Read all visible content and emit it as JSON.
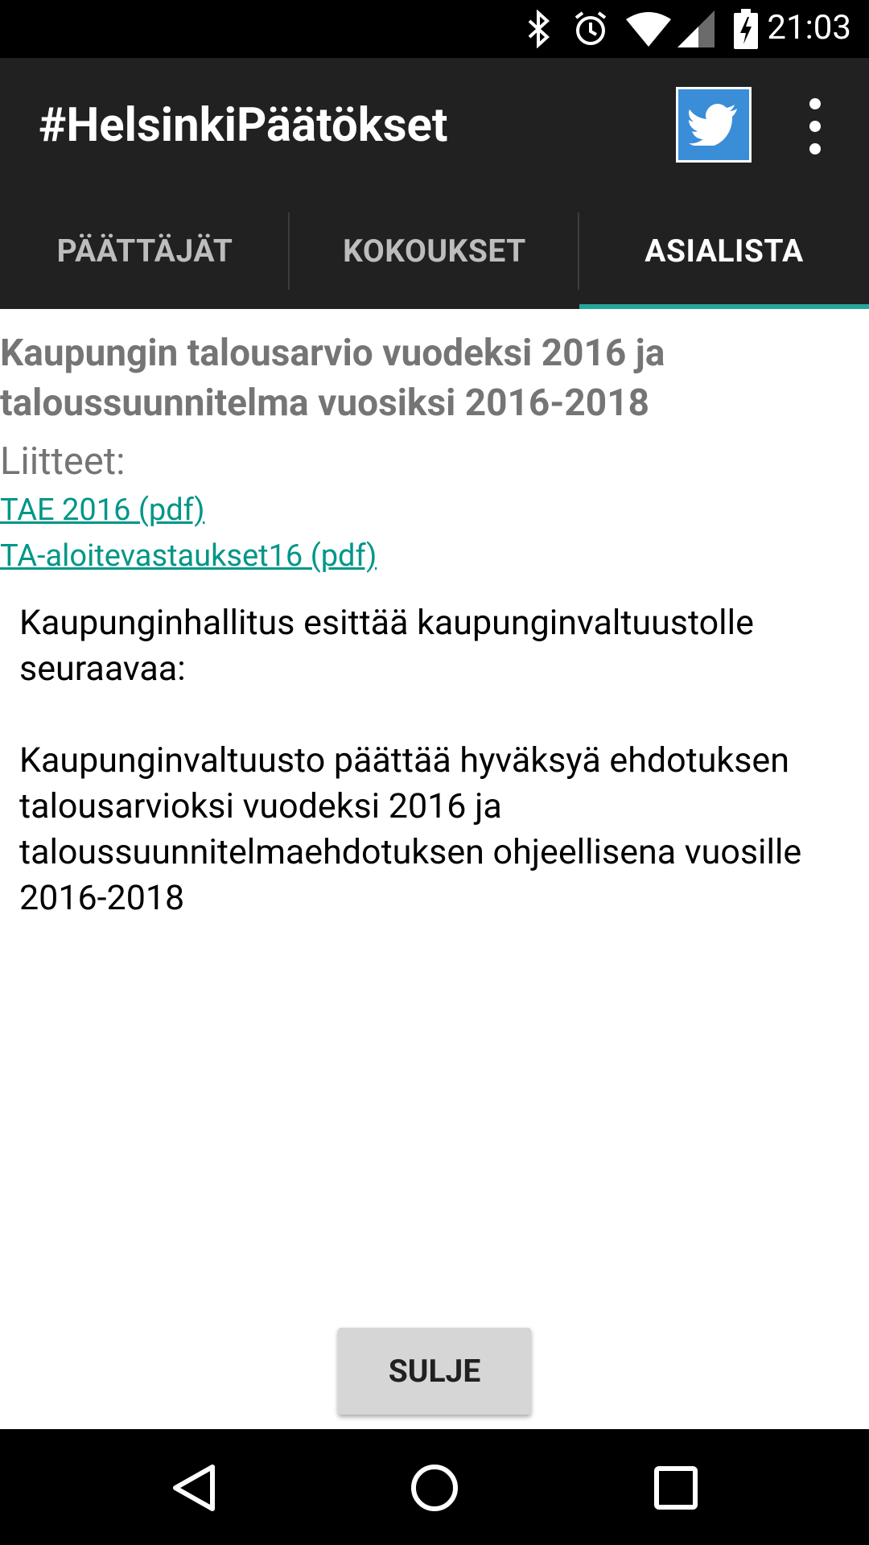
{
  "status_bar": {
    "time": "21:03",
    "icons": [
      "bluetooth-icon",
      "alarm-icon",
      "wifi-icon",
      "cell-signal-icon",
      "battery-charging-icon"
    ],
    "background": "#000000"
  },
  "app_bar": {
    "title": "#HelsinkiPäätökset",
    "background": "#212121",
    "actions": [
      "twitter-icon",
      "overflow-menu-icon"
    ]
  },
  "tabs": [
    {
      "label": "PÄÄTTÄJÄT",
      "active": false
    },
    {
      "label": "KOKOUKSET",
      "active": false
    },
    {
      "label": "ASIALISTA",
      "active": true
    }
  ],
  "accent_color": "#26a69a",
  "document": {
    "title": "Kaupungin talousarvio vuodeksi 2016 ja taloussuunnitelma vuosiksi 2016-2018",
    "attachments_label": "Liitteet:",
    "attachments": [
      {
        "label": "TAE 2016 (pdf)"
      },
      {
        "label": "TA-aloitevastaukset16 (pdf)"
      }
    ],
    "body": [
      "Kaupunginhallitus esittää kaupunginvaltuustolle seuraavaa:",
      "Kaupunginvaltuusto päättää hyväksyä ehdotuksen talousarvioksi vuodeksi 2016 ja taloussuunnitelmaehdotuksen ohjeellisena vuosille 2016-2018"
    ]
  },
  "close_button": {
    "label": "SULJE"
  },
  "nav_bar": {
    "buttons": [
      "back-icon",
      "home-icon",
      "recents-icon"
    ]
  }
}
